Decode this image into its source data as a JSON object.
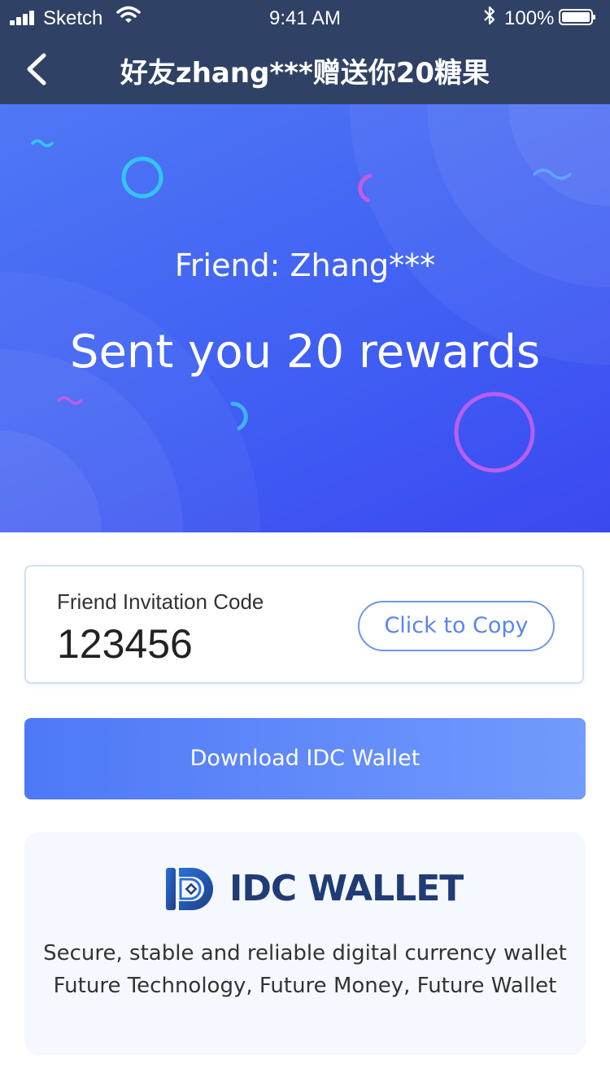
{
  "status_bar": {
    "carrier": "Sketch",
    "time": "9:41 AM",
    "battery_percent": "100%",
    "signal_icon": "signal-bars-icon",
    "wifi_icon": "wifi-icon",
    "bluetooth_icon": "bluetooth-icon",
    "battery_icon": "battery-icon"
  },
  "nav": {
    "back_icon": "chevron-left-icon",
    "title": "好友zhang***赠送你20糖果"
  },
  "hero": {
    "subtitle": "Friend: Zhang***",
    "headline": "Sent you 20 rewards"
  },
  "invite": {
    "label": "Friend Invitation Code",
    "code": "123456",
    "copy_label": "Click to Copy"
  },
  "download": {
    "label": "Download IDC Wallet"
  },
  "brand": {
    "logo_icon": "idc-logo-icon",
    "name": "IDC WALLET",
    "tagline_1": "Secure, stable and reliable digital currency wallet",
    "tagline_2": "Future Technology, Future Money, Future Wallet"
  },
  "colors": {
    "nav_bg": "#2f4265",
    "hero_start": "#4f78f5",
    "hero_end": "#3b48f0",
    "button_start": "#4e78f7",
    "button_end": "#729bfd",
    "brand_text": "#1f3c74",
    "card_bg": "#f5f8fe"
  }
}
